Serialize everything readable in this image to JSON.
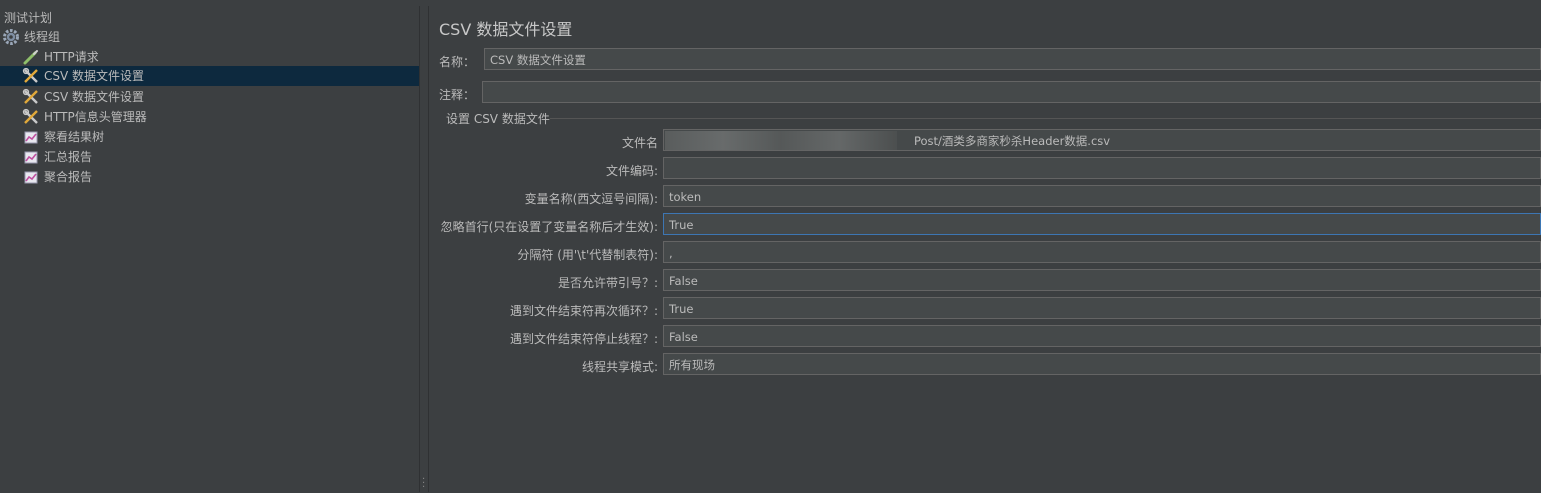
{
  "tree": {
    "items": [
      {
        "label": "测试计划",
        "icon": "none"
      },
      {
        "label": "线程组",
        "icon": "gear-icon"
      },
      {
        "label": "HTTP请求",
        "icon": "pipette-icon"
      },
      {
        "label": "CSV 数据文件设置",
        "icon": "wrench-icon"
      },
      {
        "label": "CSV 数据文件设置",
        "icon": "wrench-icon"
      },
      {
        "label": "HTTP信息头管理器",
        "icon": "wrench-icon"
      },
      {
        "label": "察看结果树",
        "icon": "chart-icon"
      },
      {
        "label": "汇总报告",
        "icon": "chart-icon"
      },
      {
        "label": "聚合报告",
        "icon": "chart-icon"
      }
    ],
    "selected_index": 3
  },
  "panel": {
    "title": "CSV 数据文件设置",
    "name_label": "名称：",
    "name_value": "CSV 数据文件设置",
    "comment_label": "注释：",
    "comment_value": "",
    "group_title": "设置 CSV 数据文件",
    "fields": [
      {
        "label": "文件名",
        "value": "Post/酒类多商家秒杀Header数据.csv"
      },
      {
        "label": "文件编码:",
        "value": ""
      },
      {
        "label": "变量名称(西文逗号间隔):",
        "value": "token"
      },
      {
        "label": "忽略首行(只在设置了变量名称后才生效):",
        "value": "True"
      },
      {
        "label": "分隔符 (用'\\t'代替制表符):",
        "value": ","
      },
      {
        "label": "是否允许带引号？:",
        "value": "False"
      },
      {
        "label": "遇到文件结束符再次循环？:",
        "value": "True"
      },
      {
        "label": "遇到文件结束符停止线程？:",
        "value": "False"
      },
      {
        "label": "线程共享模式:",
        "value": "所有现场"
      }
    ]
  },
  "colors": {
    "background": "#3c3f41",
    "selection": "#0d293e",
    "field_bg": "#45494a",
    "focus_border": "#3d76b3"
  }
}
